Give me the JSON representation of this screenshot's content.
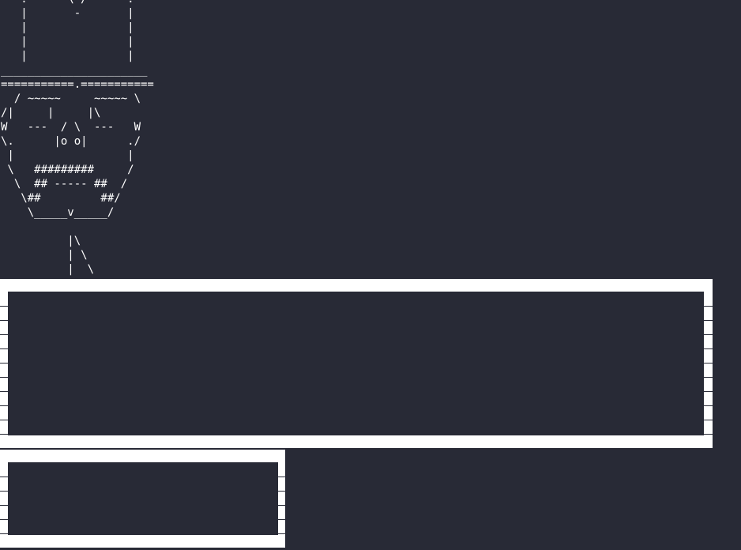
{
  "terminal": {
    "ascii_art": "   .------\\ /------.\n   |       -       |\n   |               |\n   |               |\n   |               |\n______________________\n===========.===========\n  / ~~~~~     ~~~~~ \\\n/|     |     |\\\nW   ---  / \\  ---   W\n\\.      |o o|      ./\n |                 |\n \\   #########     /\n  \\  ## ----- ##  /\n   \\##         ##/\n    \\_____v_____/\n\n          |\\\n          | \\\n          |  \\",
    "background_color": "#282a36",
    "foreground_color": "#ffffff"
  },
  "panels": [
    {
      "name": "large-output-box"
    },
    {
      "name": "small-output-box"
    }
  ]
}
